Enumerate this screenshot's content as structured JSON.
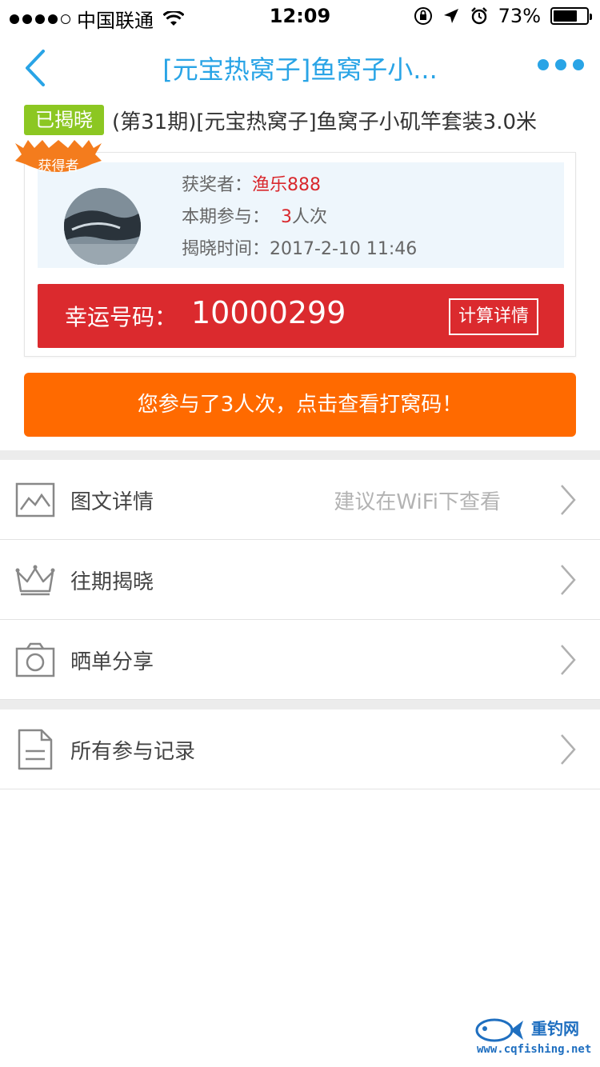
{
  "status_bar": {
    "carrier": "中国联通",
    "time": "12:09",
    "battery": "73%",
    "battery_level": 0.73
  },
  "nav": {
    "title": "[元宝热窝子]鱼窝子小..."
  },
  "product": {
    "status_tag": "已揭晓",
    "title": "(第31期)[元宝热窝子]鱼窝子小矶竿套装3.0米"
  },
  "winner": {
    "badge": "获得者",
    "winner_label": "获奖者：",
    "winner_name": "渔乐888",
    "participation_label": "本期参与：",
    "participation_count": "3",
    "participation_unit": "人次",
    "reveal_time_label": "揭晓时间：",
    "reveal_time": "2017-2-10 11:46",
    "lucky_label": "幸运号码：",
    "lucky_number": "10000299",
    "calc_button": "计算详情"
  },
  "participate_button": "您参与了3人次，点击查看打窝码！",
  "menu": {
    "items": [
      {
        "label": "图文详情",
        "hint": "建议在WiFi下查看",
        "icon": "image-icon"
      },
      {
        "label": "往期揭晓",
        "hint": "",
        "icon": "crown-icon"
      },
      {
        "label": "晒单分享",
        "hint": "",
        "icon": "camera-icon"
      },
      {
        "label": "所有参与记录",
        "hint": "",
        "icon": "document-icon"
      }
    ]
  },
  "watermark": {
    "brand": "重钓网",
    "url": "www.cqfishing.net"
  },
  "colors": {
    "accent_blue": "#29a4e6",
    "tag_green": "#8cc722",
    "lucky_red": "#db2a2e",
    "button_orange": "#ff6a00",
    "highlight_red": "#d9282d"
  }
}
